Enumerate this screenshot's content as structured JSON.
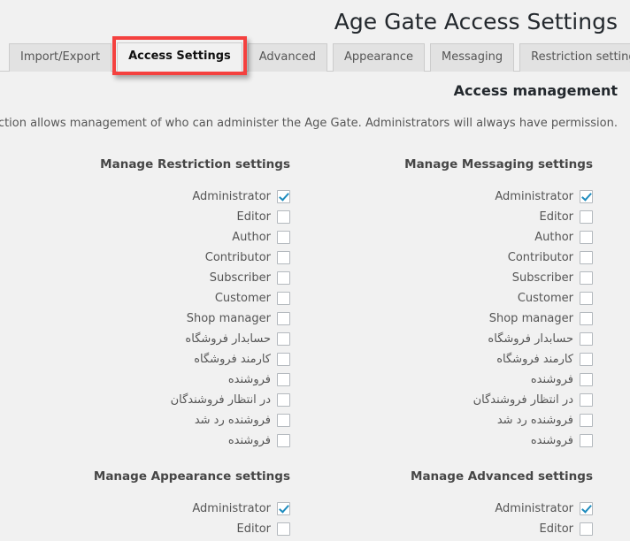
{
  "page": {
    "title": "Age Gate Access Settings",
    "background_color": "#f1f1f1"
  },
  "tabs": {
    "items": [
      {
        "label": "Import/Export",
        "active": false
      },
      {
        "label": "Access Settings",
        "active": true
      },
      {
        "label": "Advanced",
        "active": false
      },
      {
        "label": "Appearance",
        "active": false
      },
      {
        "label": "Messaging",
        "active": false
      },
      {
        "label": "Restriction settings",
        "active": false
      }
    ],
    "highlight_color": "#f4413f"
  },
  "section": {
    "heading": "Access management",
    "description": ".This section allows management of who can administer the Age Gate. Administrators will always have permission"
  },
  "permissions": {
    "accent_color": "#1e8cbe",
    "blocks": [
      {
        "title": "Manage Restriction settings",
        "roles": [
          {
            "label": "Administrator",
            "checked": true,
            "rtl": false
          },
          {
            "label": "Editor",
            "checked": false,
            "rtl": false
          },
          {
            "label": "Author",
            "checked": false,
            "rtl": false
          },
          {
            "label": "Contributor",
            "checked": false,
            "rtl": false
          },
          {
            "label": "Subscriber",
            "checked": false,
            "rtl": false
          },
          {
            "label": "Customer",
            "checked": false,
            "rtl": false
          },
          {
            "label": "Shop manager",
            "checked": false,
            "rtl": false
          },
          {
            "label": "حسابدار فروشگاه",
            "checked": false,
            "rtl": true
          },
          {
            "label": "کارمند فروشگاه",
            "checked": false,
            "rtl": true
          },
          {
            "label": "فروشنده",
            "checked": false,
            "rtl": true
          },
          {
            "label": "در انتظار فروشندگان",
            "checked": false,
            "rtl": true
          },
          {
            "label": "فروشنده رد شد",
            "checked": false,
            "rtl": true
          },
          {
            "label": "فروشنده",
            "checked": false,
            "rtl": true
          }
        ]
      },
      {
        "title": "Manage Messaging settings",
        "roles": [
          {
            "label": "Administrator",
            "checked": true,
            "rtl": false
          },
          {
            "label": "Editor",
            "checked": false,
            "rtl": false
          },
          {
            "label": "Author",
            "checked": false,
            "rtl": false
          },
          {
            "label": "Contributor",
            "checked": false,
            "rtl": false
          },
          {
            "label": "Subscriber",
            "checked": false,
            "rtl": false
          },
          {
            "label": "Customer",
            "checked": false,
            "rtl": false
          },
          {
            "label": "Shop manager",
            "checked": false,
            "rtl": false
          },
          {
            "label": "حسابدار فروشگاه",
            "checked": false,
            "rtl": true
          },
          {
            "label": "کارمند فروشگاه",
            "checked": false,
            "rtl": true
          },
          {
            "label": "فروشنده",
            "checked": false,
            "rtl": true
          },
          {
            "label": "در انتظار فروشندگان",
            "checked": false,
            "rtl": true
          },
          {
            "label": "فروشنده رد شد",
            "checked": false,
            "rtl": true
          },
          {
            "label": "فروشنده",
            "checked": false,
            "rtl": true
          }
        ]
      },
      {
        "title": "Manage Appearance settings",
        "roles": [
          {
            "label": "Administrator",
            "checked": true,
            "rtl": false
          },
          {
            "label": "Editor",
            "checked": false,
            "rtl": false
          }
        ]
      },
      {
        "title": "Manage Advanced settings",
        "roles": [
          {
            "label": "Administrator",
            "checked": true,
            "rtl": false
          },
          {
            "label": "Editor",
            "checked": false,
            "rtl": false
          }
        ]
      }
    ]
  }
}
